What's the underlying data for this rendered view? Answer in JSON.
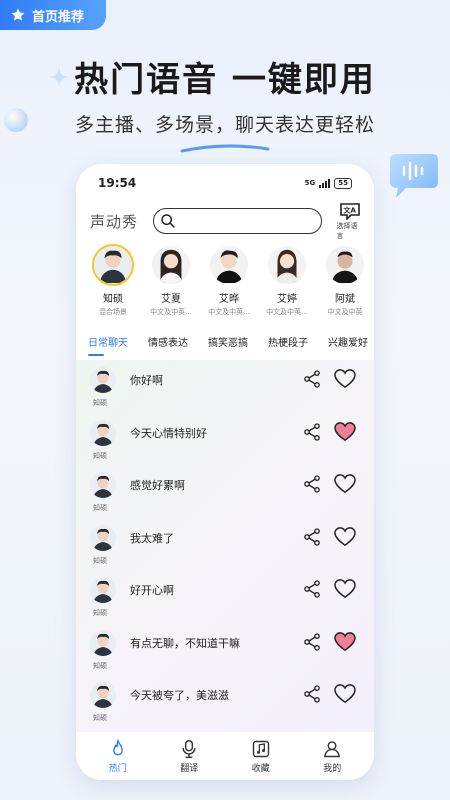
{
  "badge": {
    "label": "首页推荐"
  },
  "headline": "热门语音 一键即用",
  "subline": "多主播、多场景，聊天表达更轻松",
  "status": {
    "time": "19:54",
    "network": "5G",
    "battery": "55"
  },
  "search": {
    "brand": "声动秀",
    "value": "",
    "placeholder": "",
    "lang_label": "选择语言"
  },
  "speakers": [
    {
      "name": "知硕",
      "tag": "混合场景",
      "active": true
    },
    {
      "name": "艾夏",
      "tag": "中文及中英...",
      "active": false
    },
    {
      "name": "艾晔",
      "tag": "中文及中英...",
      "active": false
    },
    {
      "name": "艾婷",
      "tag": "中文及中英...",
      "active": false
    },
    {
      "name": "阿斌",
      "tag": "中文及中英",
      "active": false
    }
  ],
  "tabs": [
    {
      "label": "日常聊天",
      "active": true
    },
    {
      "label": "情感表达",
      "active": false
    },
    {
      "label": "搞笑恶搞",
      "active": false
    },
    {
      "label": "热梗段子",
      "active": false
    },
    {
      "label": "兴趣爱好",
      "active": false
    }
  ],
  "phrases": [
    {
      "speaker": "知硕",
      "text": "你好啊",
      "liked": false
    },
    {
      "speaker": "知硕",
      "text": "今天心情特别好",
      "liked": true
    },
    {
      "speaker": "知硕",
      "text": "感觉好累啊",
      "liked": false
    },
    {
      "speaker": "知硕",
      "text": "我太难了",
      "liked": false
    },
    {
      "speaker": "知硕",
      "text": "好开心啊",
      "liked": false
    },
    {
      "speaker": "知硕",
      "text": "有点无聊，不知道干嘛",
      "liked": true
    },
    {
      "speaker": "知硕",
      "text": "今天被夸了，美滋滋",
      "liked": false
    }
  ],
  "tabbar": [
    {
      "label": "热门",
      "icon": "flame-icon",
      "active": true
    },
    {
      "label": "翻译",
      "icon": "microphone-icon",
      "active": false
    },
    {
      "label": "收藏",
      "icon": "music-note-icon",
      "active": false
    },
    {
      "label": "我的",
      "icon": "person-icon",
      "active": false
    }
  ],
  "colors": {
    "accent": "#2f7cf6",
    "liked": "#f0809a",
    "active_ring": "#f6c624"
  }
}
